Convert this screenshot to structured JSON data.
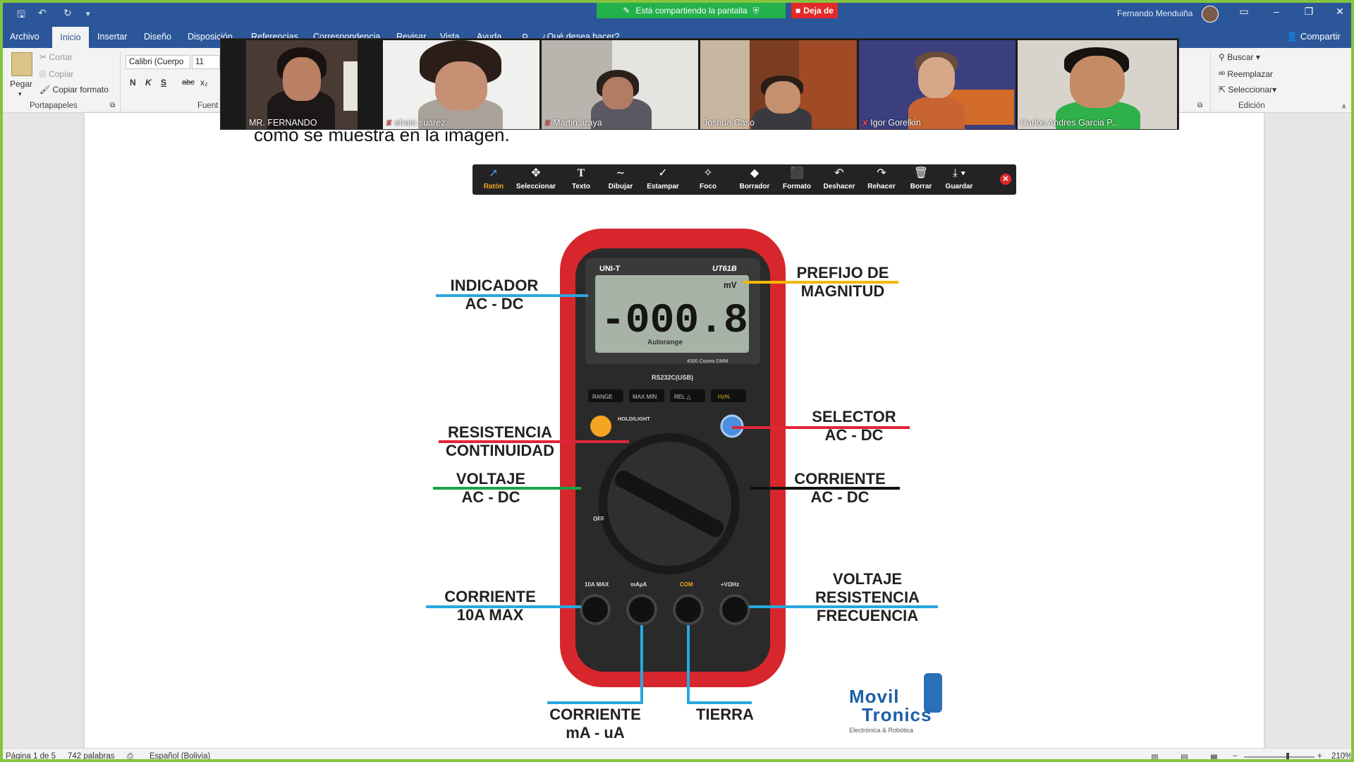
{
  "titlebar": {
    "share_banner": "Está compartiendo la pantalla",
    "stop_label": "Deja de",
    "user_name": "Fernando Menduiña"
  },
  "tabs": {
    "archivo": "Archivo",
    "inicio": "Inicio",
    "insertar": "Insertar",
    "diseno": "Diseño",
    "disposicion": "Disposición",
    "referencias": "Referencias",
    "correspondencia": "Correspondencia",
    "revisar": "Revisar",
    "vista": "Vista",
    "ayuda": "Ayuda",
    "search": "¿Qué desea hacer?",
    "compartir": "Compartir"
  },
  "ribbon": {
    "pegar": "Pegar",
    "cortar": "Cortar",
    "copiar": "Copiar",
    "copiar_formato": "Copiar formato",
    "portapapeles": "Portapapeles",
    "font_name": "Calibri (Cuerpo",
    "font_size": "11",
    "bold": "N",
    "italic": "K",
    "underline": "S",
    "strike": "abc",
    "subscript": "x₂",
    "fuente": "Fuent",
    "buscar": "Buscar",
    "reemplazar": "Reemplazar",
    "seleccionar": "Seleccionar",
    "edicion": "Edición"
  },
  "participants": [
    {
      "name": "MR. FERNANDO",
      "muted": false
    },
    {
      "name": "efrain suarez",
      "muted": true
    },
    {
      "name": "Martin araya",
      "muted": true
    },
    {
      "name": "Joshua Caso",
      "muted": false
    },
    {
      "name": "Igor Gorelkin",
      "muted": true
    },
    {
      "name": "Carlos Andres Garcia P...",
      "muted": false
    }
  ],
  "document": {
    "text": "como se muestra en la imagen."
  },
  "annotate": {
    "tools": [
      "Ratón",
      "Seleccionar",
      "Texto",
      "Dibujar",
      "Estampar",
      "Foco",
      "Borrador",
      "Formato",
      "Deshacer",
      "Rehacer",
      "Borrar",
      "Guardar"
    ],
    "icons": [
      "cursor-icon",
      "move-icon",
      "text-icon",
      "draw-icon",
      "stamp-icon",
      "spotlight-icon",
      "eraser-icon",
      "format-icon",
      "undo-icon",
      "redo-icon",
      "trash-icon",
      "save-icon"
    ],
    "active": "Ratón",
    "active_color": "#f6a41c"
  },
  "diagram": {
    "indicador": "INDICADOR",
    "indicador_sub": "AC - DC",
    "prefijo": "PREFIJO  DE",
    "prefijo_sub": "MAGNITUD",
    "resistencia": "RESISTENCIA",
    "resistencia_sub": "CONTINUIDAD",
    "selector": "SELECTOR",
    "selector_sub": "AC - DC",
    "voltaje": "VOLTAJE",
    "voltaje_sub": "AC - DC",
    "corriente": "CORRIENTE",
    "corriente_sub": "AC - DC",
    "corriente10": "CORRIENTE",
    "corriente10_sub": "10A MAX",
    "vrf1": "VOLTAJE",
    "vrf2": "RESISTENCIA",
    "vrf3": "FRECUENCIA",
    "corriente_ma": "CORRIENTE",
    "corriente_ma_sub": "mA - uA",
    "tierra": "TIERRA",
    "logo_1": "Movil",
    "logo_2": "Tronics",
    "logo_sub": "Electrónica & Robótica",
    "meter_brand": "UNI-T",
    "meter_model": "UT61B",
    "meter_reading": "-000.8",
    "meter_unit": "mV",
    "meter_autorange": "Autorange",
    "meter_counts": "4000 Counts DMM",
    "meter_rs232": "RS232C(USB)",
    "btn_range": "RANGE",
    "btn_maxmin": "MAX MIN",
    "btn_rel": "REL △",
    "btn_hz": "Hz%",
    "holdlight": "HOLD/LIGHT",
    "off": "OFF",
    "jack_10a": "10A MAX",
    "jack_ma": "mAµA",
    "jack_com": "COM",
    "jack_v": "+VΩHz",
    "colors": {
      "blue": "#2aa7de",
      "yellow": "#f5b800",
      "red": "#e0253a",
      "green": "#1aa34a",
      "black": "#111111"
    }
  },
  "statusbar": {
    "page": "Página 1 de 5",
    "words": "742 palabras",
    "language": "Español (Bolivia)",
    "zoom": "210%"
  }
}
